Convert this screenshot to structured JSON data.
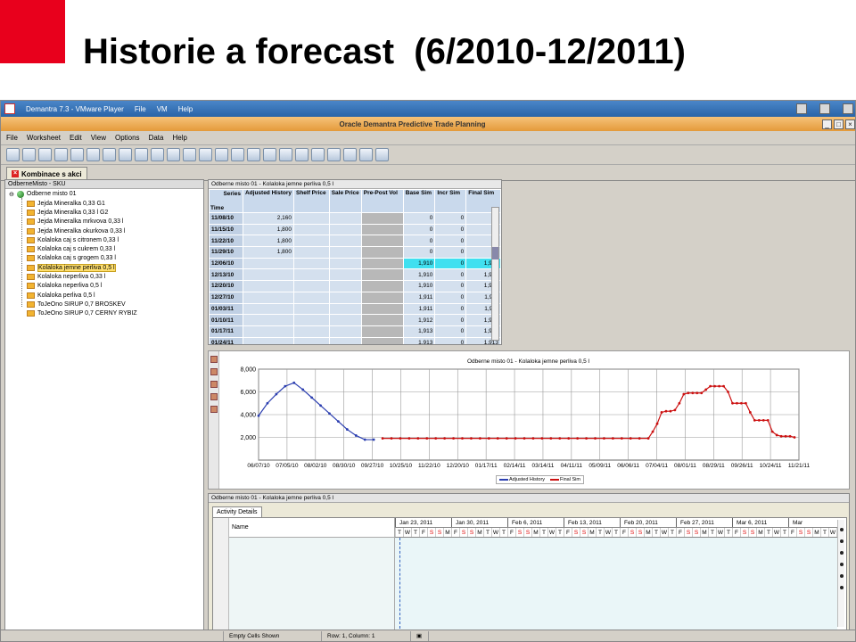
{
  "slide": {
    "title": "Historie a forecast  (6/2010-12/2011)"
  },
  "vm_window": {
    "title": "Demantra 7.3 - VMware Player",
    "menus": [
      "File",
      "VM",
      "Help"
    ]
  },
  "app": {
    "title": "Oracle Demantra Predictive Trade Planning",
    "menu": [
      "File",
      "Worksheet",
      "Edit",
      "View",
      "Options",
      "Data",
      "Help"
    ],
    "worksheet_tab": "Kombinace s akci"
  },
  "tree": {
    "header": "OdberneMisto - SKU",
    "root": "Odberne misto 01",
    "items": [
      "Jejda Mineralka 0,33 G1",
      "Jejda Mineralka 0,33 l G2",
      "Jejda Mineralka mrkvova  0,33 l",
      "Jejda Mineralka okurkova 0,33 l",
      "Kolaloka caj s citronem 0,33 l",
      "Kolaloka caj s cukrem 0,33 l",
      "Kolaloka caj s grogem 0,33 l",
      "Kolaloka jemne perliva 0,5 l",
      "Kolaloka neperliva  0,33 l",
      "Kolaloka neperliva 0,5 l",
      "Kolaloka perliva 0,5 l",
      "ToJeOno SIRUP 0,7 BROSKEV",
      "ToJeOno SIRUP 0,7 CERNY RYBIZ"
    ],
    "selected_index": 7
  },
  "grid": {
    "header": "Odberne misto 01 - Kolaloka jemne perliva 0,5 l",
    "series_label": "Series",
    "time_label": "Time",
    "columns": [
      "Adjusted History",
      "Shelf Price",
      "Sale Price",
      "Pre-Post Vol",
      "Base Sim",
      "Incr Sim",
      "Final Sim"
    ],
    "rows": [
      {
        "date": "11/08/10",
        "adj": "2,160",
        "base": "0",
        "incr": "0",
        "final": ""
      },
      {
        "date": "11/15/10",
        "adj": "1,800",
        "base": "0",
        "incr": "0",
        "final": ""
      },
      {
        "date": "11/22/10",
        "adj": "1,800",
        "base": "0",
        "incr": "0",
        "final": ""
      },
      {
        "date": "11/29/10",
        "adj": "1,800",
        "base": "0",
        "incr": "0",
        "final": ""
      },
      {
        "date": "12/06/10",
        "adj": "",
        "base": "1,910",
        "incr": "0",
        "final": "1,910"
      },
      {
        "date": "12/13/10",
        "adj": "",
        "base": "1,910",
        "incr": "0",
        "final": "1,910"
      },
      {
        "date": "12/20/10",
        "adj": "",
        "base": "1,910",
        "incr": "0",
        "final": "1,910"
      },
      {
        "date": "12/27/10",
        "adj": "",
        "base": "1,911",
        "incr": "0",
        "final": "1,911"
      },
      {
        "date": "01/03/11",
        "adj": "",
        "base": "1,911",
        "incr": "0",
        "final": "1,911"
      },
      {
        "date": "01/10/11",
        "adj": "",
        "base": "1,912",
        "incr": "0",
        "final": "1,912"
      },
      {
        "date": "01/17/11",
        "adj": "",
        "base": "1,913",
        "incr": "0",
        "final": "1,913"
      },
      {
        "date": "01/24/11",
        "adj": "",
        "base": "1,913",
        "incr": "0",
        "final": "1,913"
      }
    ]
  },
  "chart_data": {
    "type": "line",
    "title": "Odberne misto 01 - Kolaloka jemne perliva 0,5 l",
    "x": [
      "06/07/10",
      "07/05/10",
      "08/02/10",
      "08/30/10",
      "09/27/10",
      "10/25/10",
      "11/22/10",
      "12/20/10",
      "01/17/11",
      "02/14/11",
      "03/14/11",
      "04/11/11",
      "05/09/11",
      "06/06/11",
      "07/04/11",
      "08/01/11",
      "08/29/11",
      "09/26/11",
      "10/24/11",
      "11/21/11"
    ],
    "yticks": [
      "2,000",
      "4,000",
      "6,000",
      "8,000"
    ],
    "ylim": [
      0,
      8000
    ],
    "series": [
      {
        "name": "Adjusted History",
        "color": "#2c3fb0",
        "points": [
          [
            0,
            3900
          ],
          [
            2,
            5000
          ],
          [
            4,
            5800
          ],
          [
            6,
            6500
          ],
          [
            8,
            6800
          ],
          [
            10,
            6200
          ],
          [
            12,
            5500
          ],
          [
            14,
            4800
          ],
          [
            16,
            4100
          ],
          [
            18,
            3400
          ],
          [
            20,
            2700
          ],
          [
            22,
            2160
          ],
          [
            24,
            1800
          ],
          [
            26,
            1800
          ]
        ]
      },
      {
        "name": "Final Sim",
        "color": "#cc1111",
        "points": [
          [
            28,
            1910
          ],
          [
            30,
            1910
          ],
          [
            32,
            1910
          ],
          [
            34,
            1911
          ],
          [
            36,
            1912
          ],
          [
            38,
            1913
          ],
          [
            40,
            1913
          ],
          [
            42,
            1913
          ],
          [
            44,
            1913
          ],
          [
            46,
            1913
          ],
          [
            48,
            1913
          ],
          [
            50,
            1913
          ],
          [
            52,
            1913
          ],
          [
            54,
            1913
          ],
          [
            56,
            1913
          ],
          [
            58,
            1913
          ],
          [
            60,
            1913
          ],
          [
            62,
            1913
          ],
          [
            64,
            1913
          ],
          [
            66,
            1913
          ],
          [
            68,
            1913
          ],
          [
            70,
            1913
          ],
          [
            72,
            1913
          ],
          [
            74,
            1913
          ],
          [
            76,
            1913
          ],
          [
            78,
            1913
          ],
          [
            80,
            1913
          ],
          [
            82,
            1913
          ],
          [
            84,
            1913
          ],
          [
            86,
            1913
          ],
          [
            88,
            1913
          ],
          [
            89,
            2500
          ],
          [
            90,
            3200
          ],
          [
            91,
            4200
          ],
          [
            92,
            4300
          ],
          [
            93,
            4300
          ],
          [
            94,
            4400
          ],
          [
            95,
            5000
          ],
          [
            96,
            5800
          ],
          [
            97,
            5900
          ],
          [
            98,
            5900
          ],
          [
            99,
            5900
          ],
          [
            100,
            5900
          ],
          [
            101,
            6200
          ],
          [
            102,
            6500
          ],
          [
            103,
            6500
          ],
          [
            104,
            6500
          ],
          [
            105,
            6500
          ],
          [
            106,
            6000
          ],
          [
            107,
            5000
          ],
          [
            108,
            5000
          ],
          [
            109,
            5000
          ],
          [
            110,
            5000
          ],
          [
            111,
            4200
          ],
          [
            112,
            3500
          ],
          [
            113,
            3500
          ],
          [
            114,
            3500
          ],
          [
            115,
            3500
          ],
          [
            116,
            2500
          ],
          [
            117,
            2200
          ],
          [
            118,
            2100
          ],
          [
            119,
            2100
          ],
          [
            120,
            2100
          ],
          [
            121,
            2000
          ]
        ]
      }
    ],
    "legend": [
      "Adjusted History",
      "Final Sim"
    ],
    "grid": true
  },
  "activity": {
    "header": "Odberne misto 01 - Kolaloka jemne perliva 0,5 l",
    "tab": "Activity Details",
    "name_label": "Name",
    "weeks": [
      "Jan 23, 2011",
      "Jan 30, 2011",
      "Feb 6, 2011",
      "Feb 13, 2011",
      "Feb 20, 2011",
      "Feb 27, 2011",
      "Mar 6, 2011",
      "Mar"
    ],
    "days": [
      "T",
      "W",
      "T",
      "F",
      "S",
      "S",
      "M"
    ]
  },
  "status": {
    "empty_cells": "Empty Cells Shown",
    "position": "Row: 1, Column: 1"
  }
}
